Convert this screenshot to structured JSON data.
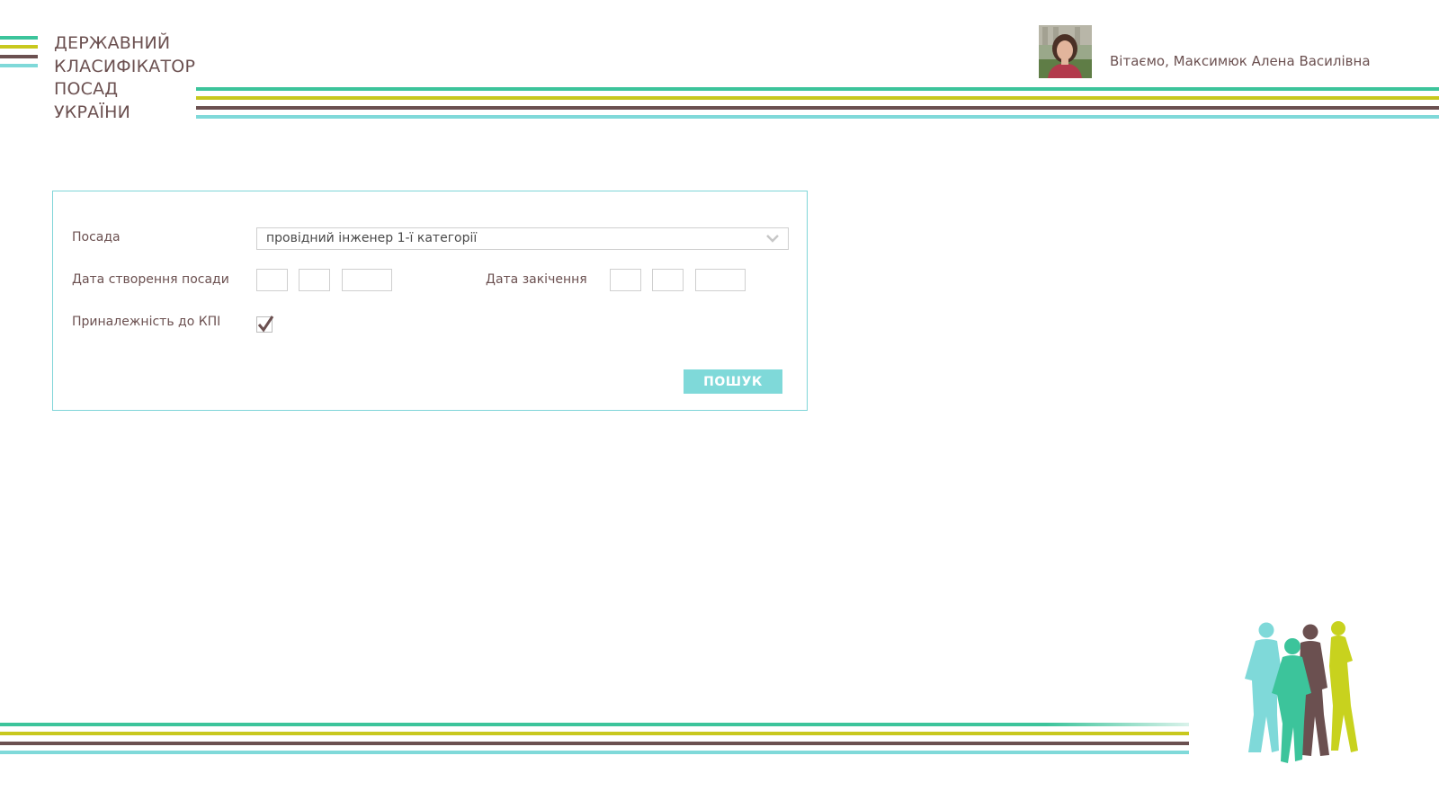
{
  "app": {
    "logo_lines": [
      "ДЕРЖАВНИЙ",
      "КЛАСИФІКАТОР",
      "ПОСАД",
      "УКРАЇНИ"
    ]
  },
  "header": {
    "greeting": "Вітаємо, Максимюк Алена Василівна",
    "avatar_icon": "user-photo"
  },
  "colors": {
    "stripe_green": "#3cc49b",
    "stripe_yellow": "#c8c81e",
    "stripe_brown": "#6b5050",
    "stripe_cyan": "#7fd9d9",
    "text": "#6b5050",
    "button": "#7fd9d9"
  },
  "form": {
    "position_label": "Посада",
    "position_value": "провідний інженер 1-ї категорії",
    "create_date_label": "Дата створення посади",
    "end_date_label": "Дата закічення",
    "kpi_label": "Приналежність до КПІ",
    "kpi_checked": true,
    "search_button": "ПОШУК"
  }
}
